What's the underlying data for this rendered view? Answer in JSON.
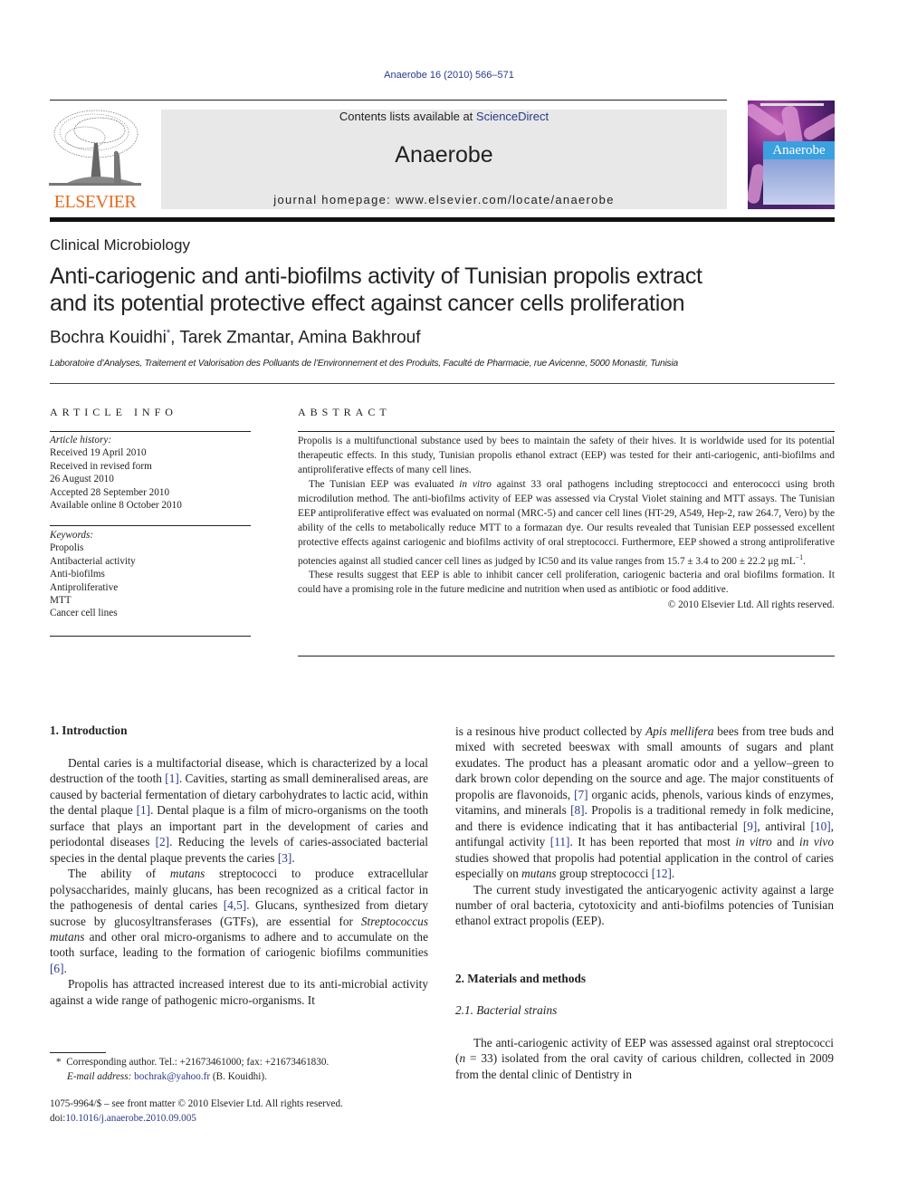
{
  "header": {
    "citation": "Anaerobe 16 (2010) 566–571",
    "contents_prefix": "Contents lists available at ",
    "contents_link": "ScienceDirect",
    "journal_name": "Anaerobe",
    "homepage": "journal homepage: www.elsevier.com/locate/anaerobe",
    "publisher_logo_text": "ELSEVIER",
    "cover_title": "Anaerobe",
    "colors": {
      "publisher_orange": "#e86a1f",
      "link_blue": "#2a3a8a",
      "masthead_gray": "#e8e8e8"
    }
  },
  "article": {
    "section": "Clinical Microbiology",
    "title_line1": "Anti-cariogenic and anti-biofilms activity of Tunisian propolis extract",
    "title_line2": "and its potential protective effect against cancer cells proliferation",
    "authors": [
      {
        "name": "Bochra Kouidhi",
        "mark": "*"
      },
      {
        "name": "Tarek Zmantar"
      },
      {
        "name": "Amina Bakhrouf"
      }
    ],
    "affiliation": "Laboratoire d’Analyses, Traitement et Valorisation des Polluants de l’Environnement et des Produits, Faculté de Pharmacie, rue Avicenne, 5000 Monastir, Tunisia"
  },
  "article_info": {
    "heading": "ARTICLE INFO",
    "history_label": "Article history:",
    "history": [
      "Received 19 April 2010",
      "Received in revised form",
      "26 August 2010",
      "Accepted 28 September 2010",
      "Available online 8 October 2010"
    ],
    "keywords_label": "Keywords:",
    "keywords": [
      "Propolis",
      "Antibacterial activity",
      "Anti-biofilms",
      "Antiproliferative",
      "MTT",
      "Cancer cell lines"
    ]
  },
  "abstract": {
    "heading": "ABSTRACT",
    "p1": "Propolis is a multifunctional substance used by bees to maintain the safety of their hives. It is worldwide used for its potential therapeutic effects. In this study, Tunisian propolis ethanol extract (EEP) was tested for their anti-cariogenic, anti-biofilms and antiproliferative effects of many cell lines.",
    "p2_a": "The Tunisian EEP was evaluated ",
    "p2_it": "in vitro",
    "p2_b": " against 33 oral pathogens including streptococci and enterococci using broth microdilution method. The anti-biofilms activity of EEP was assessed via Crystal Violet staining and MTT assays. The Tunisian EEP antiproliferative effect was evaluated on normal (MRC-5) and cancer cell lines (HT-29, A549, Hep-2, raw 264.7, Vero) by the ability of the cells to metabolically reduce MTT to a formazan dye. Our results revealed that Tunisian EEP possessed excellent protective effects against cariogenic and biofilms activity of oral streptococci. Furthermore, EEP showed a strong antiproliferative potencies against all studied cancer cell lines as judged by IC50 and its value ranges from 15.7 ± 3.4 to 200 ± 22.2 μg mL",
    "p2_sup": "−1",
    "p2_end": ".",
    "p3": "These results suggest that EEP is able to inhibit cancer cell proliferation, cariogenic bacteria and oral biofilms formation. It could have a promising role in the future medicine and nutrition when used as antibiotic or food additive.",
    "copyright": "© 2010 Elsevier Ltd. All rights reserved."
  },
  "body": {
    "intro_heading": "1.  Introduction",
    "intro_p1": [
      {
        "t": "Dental caries is a multifactorial disease, which is characterized by a local destruction of the tooth "
      },
      {
        "r": "[1]"
      },
      {
        "t": ". Cavities, starting as small demineralised areas, are caused by bacterial fermentation of dietary carbohydrates to lactic acid, within the dental plaque "
      },
      {
        "r": "[1]"
      },
      {
        "t": ". Dental plaque is a film of micro-organisms on the tooth surface that plays an important part in the development of caries and periodontal diseases "
      },
      {
        "r": "[2]"
      },
      {
        "t": ". Reducing the levels of caries-associated bacterial species in the dental plaque prevents the caries "
      },
      {
        "r": "[3]"
      },
      {
        "t": "."
      }
    ],
    "intro_p2": [
      {
        "t": "The ability of "
      },
      {
        "i": "mutans"
      },
      {
        "t": " streptococci to produce extracellular polysaccharides, mainly glucans, has been recognized as a critical factor in the pathogenesis of dental caries "
      },
      {
        "r": "[4,5]"
      },
      {
        "t": ". Glucans, synthesized from dietary sucrose by glucosyltransferases (GTFs), are essential for "
      },
      {
        "i": "Streptococcus mutans"
      },
      {
        "t": " and other oral micro-organisms to adhere and to accumulate on the tooth surface, leading to the formation of cariogenic biofilms communities "
      },
      {
        "r": "[6]"
      },
      {
        "t": "."
      }
    ],
    "intro_p3": [
      {
        "t": "Propolis has attracted increased interest due to its anti-microbial activity against a wide range of pathogenic micro-organisms. It"
      }
    ],
    "right_p1": [
      {
        "t": "is a resinous hive product collected by "
      },
      {
        "i": "Apis mellifera"
      },
      {
        "t": " bees from tree buds and mixed with secreted beeswax with small amounts of sugars and plant exudates. The product has a pleasant aromatic odor and a yellow–green to dark brown color depending on the source and age. The major constituents of propolis are flavonoids, "
      },
      {
        "r": "[7]"
      },
      {
        "t": " organic acids, phenols, various kinds of enzymes, vitamins, and minerals "
      },
      {
        "r": "[8]"
      },
      {
        "t": ". Propolis is a traditional remedy in folk medicine, and there is evidence indicating that it has antibacterial "
      },
      {
        "r": "[9]"
      },
      {
        "t": ", antiviral "
      },
      {
        "r": "[10]"
      },
      {
        "t": ", antifungal activity "
      },
      {
        "r": "[11]"
      },
      {
        "t": ". It has been reported that most "
      },
      {
        "i": "in vitro"
      },
      {
        "t": " and "
      },
      {
        "i": "in vivo"
      },
      {
        "t": " studies showed that propolis had potential application in the control of caries especially on "
      },
      {
        "i": "mutans"
      },
      {
        "t": " group streptococci "
      },
      {
        "r": "[12]"
      },
      {
        "t": "."
      }
    ],
    "right_p2": [
      {
        "t": "The current study investigated the anticaryogenic activity against a large number of oral bacteria, cytotoxicity and anti-biofilms potencies of Tunisian ethanol extract propolis (EEP)."
      }
    ],
    "methods_heading": "2.  Materials and methods",
    "sub_heading": "2.1.  Bacterial strains",
    "methods_p1": [
      {
        "t": "The anti-cariogenic activity of EEP was assessed against oral streptococci ("
      },
      {
        "i": "n"
      },
      {
        "t": " = 33) isolated from the oral cavity of carious children, collected in 2009 from the dental clinic of Dentistry in"
      }
    ]
  },
  "footnotes": {
    "corresponding_mark": "*",
    "corresponding": "Corresponding author. Tel.: +21673461000; fax: +21673461830.",
    "email_label": "E-mail address: ",
    "email": "bochrak@yahoo.fr",
    "email_suffix": " (B. Kouidhi).",
    "front_matter": "1075-9964/$ – see front matter © 2010 Elsevier Ltd. All rights reserved.",
    "doi_prefix": "doi:",
    "doi": "10.1016/j.anaerobe.2010.09.005"
  }
}
